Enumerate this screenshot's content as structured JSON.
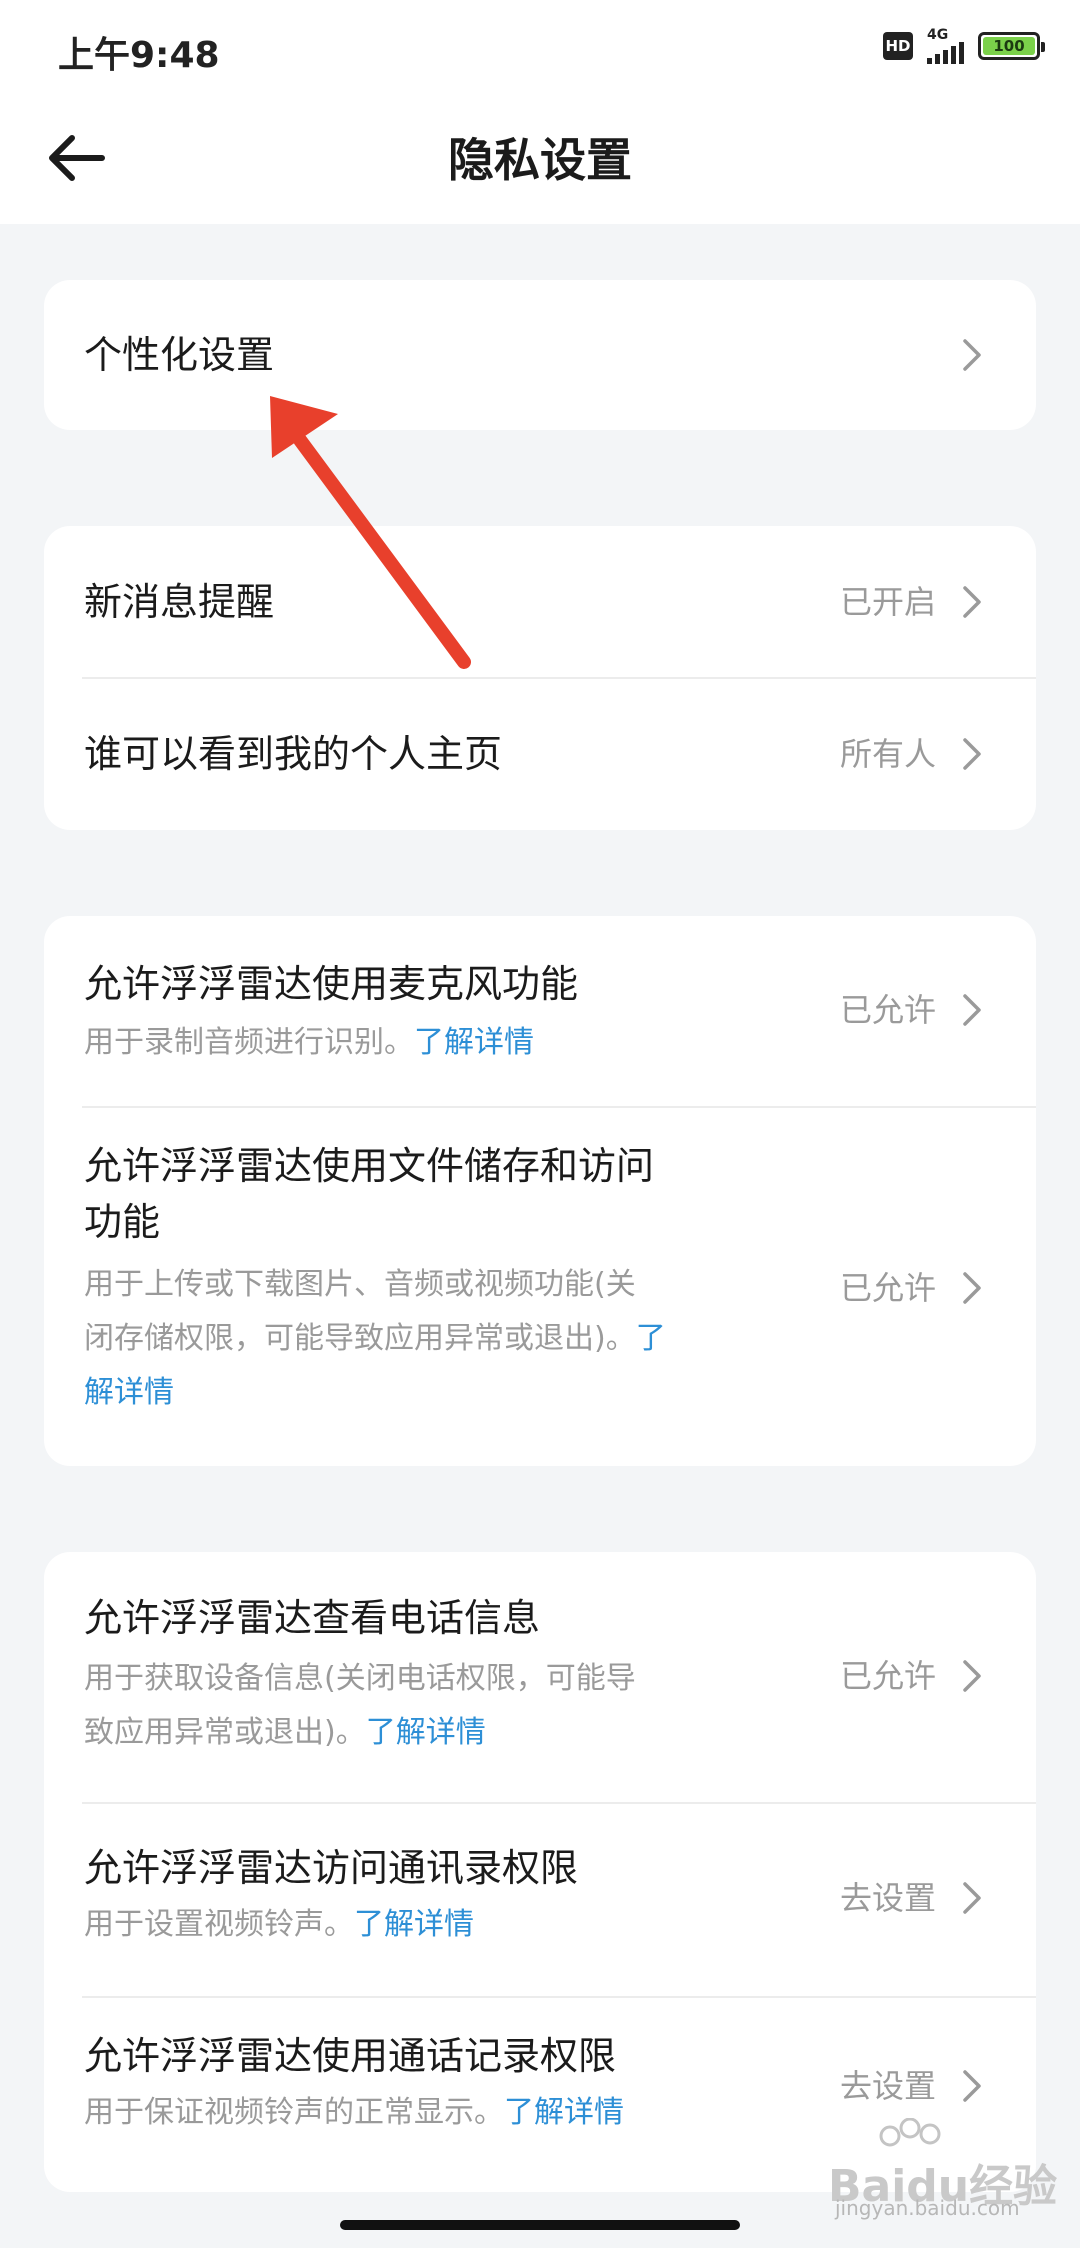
{
  "status_bar": {
    "time": "上午9:48",
    "hd": "HD",
    "network": "4G",
    "battery": "100"
  },
  "header": {
    "title": "隐私设置"
  },
  "sections": [
    {
      "items": [
        {
          "title": "个性化设置",
          "value": ""
        }
      ]
    },
    {
      "items": [
        {
          "title": "新消息提醒",
          "value": "已开启"
        },
        {
          "title": "谁可以看到我的个人主页",
          "value": "所有人"
        }
      ]
    },
    {
      "items": [
        {
          "title": "允许浮浮雷达使用麦克风功能",
          "desc": "用于录制音频进行识别。",
          "link": "了解详情",
          "value": "已允许"
        },
        {
          "title_line1": "允许浮浮雷达使用文件储存和访问",
          "title_line2": "功能",
          "desc_line1": "用于上传或下载图片、音频或视频功能(关",
          "desc_line2": "闭存储权限，可能导致应用异常或退出)。",
          "link_part1": "了",
          "link_part2": "解详情",
          "value": "已允许"
        }
      ]
    },
    {
      "items": [
        {
          "title": "允许浮浮雷达查看电话信息",
          "desc_line1": "用于获取设备信息(关闭电话权限，可能导",
          "desc_line2": "致应用异常或退出)。",
          "link": "了解详情",
          "value": "已允许"
        },
        {
          "title": "允许浮浮雷达访问通讯录权限",
          "desc": "用于设置视频铃声。",
          "link": "了解详情",
          "value": "去设置"
        },
        {
          "title": "允许浮浮雷达使用通话记录权限",
          "desc": "用于保证视频铃声的正常显示。",
          "link": "了解详情",
          "value": "去设置"
        }
      ]
    }
  ],
  "watermark": {
    "brand": "Baidu经验",
    "site": "jingyan.baidu.com"
  },
  "colors": {
    "link": "#2d8fd6",
    "annotation_arrow": "#e8402c",
    "background": "#f3f5f7"
  }
}
